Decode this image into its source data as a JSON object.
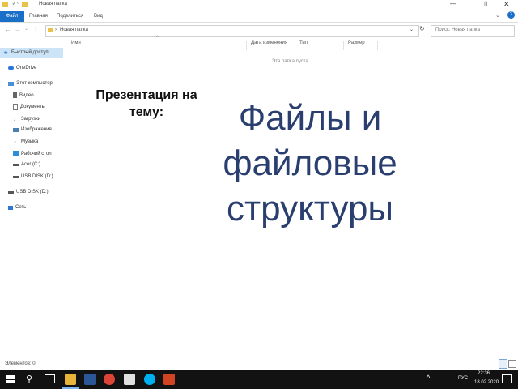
{
  "window": {
    "title": "Новая папка",
    "controls": {
      "minimize": "—",
      "maximize": "▯",
      "close": "✕"
    }
  },
  "ribbon": {
    "tabs": [
      "Файл",
      "Главная",
      "Поделиться",
      "Вид"
    ],
    "help": "?"
  },
  "address": {
    "path": "Новая папка",
    "search_placeholder": "Поиск: Новая папка"
  },
  "columns": [
    "Имя",
    "Дата изменения",
    "Тип",
    "Размер"
  ],
  "empty_text": "Эта папка пуста.",
  "nav": {
    "items": [
      {
        "label": "Быстрый доступ",
        "icon": "star-icon",
        "color": "#3b7fd6"
      },
      {
        "label": "OneDrive",
        "icon": "cloud-icon",
        "color": "#2a78d2"
      },
      {
        "label": "Этот компьютер",
        "icon": "computer-icon",
        "color": "#4a90d9"
      },
      {
        "label": "Видео",
        "icon": "video-icon",
        "color": "#666666"
      },
      {
        "label": "Документы",
        "icon": "document-icon",
        "color": "#777777"
      },
      {
        "label": "Загрузки",
        "icon": "download-icon",
        "color": "#2a78d2"
      },
      {
        "label": "Изображения",
        "icon": "image-icon",
        "color": "#4a7fb0"
      },
      {
        "label": "Музыка",
        "icon": "music-icon",
        "color": "#2a78d2"
      },
      {
        "label": "Рабочий стол",
        "icon": "desktop-icon",
        "color": "#2a8fd6"
      },
      {
        "label": "Acer (C:)",
        "icon": "drive-icon",
        "color": "#555555"
      },
      {
        "label": "USB DISK (D:)",
        "icon": "usb-drive-icon",
        "color": "#555555"
      },
      {
        "label": "USB DISK (D:)",
        "icon": "usb-drive-icon",
        "color": "#555555"
      },
      {
        "label": "Сеть",
        "icon": "network-icon",
        "color": "#2a78d2"
      }
    ]
  },
  "status": {
    "elements": "Элементов: 0"
  },
  "slide": {
    "subtitle": "Презентация на тему:",
    "title": "Файлы и файловые структуры"
  },
  "taskbar": {
    "lang": "РУС",
    "time": "22:36",
    "date": "18.02.2020",
    "apps": [
      {
        "icon": "explorer-icon",
        "color": "#e8b43a"
      },
      {
        "icon": "word-icon",
        "color": "#2b5797"
      },
      {
        "icon": "chrome-icon",
        "color": "#db4437"
      },
      {
        "icon": "app-icon",
        "color": "#e0e0e0"
      },
      {
        "icon": "skype-icon",
        "color": "#00aff0"
      },
      {
        "icon": "powerpoint-icon",
        "color": "#d04423"
      }
    ]
  }
}
